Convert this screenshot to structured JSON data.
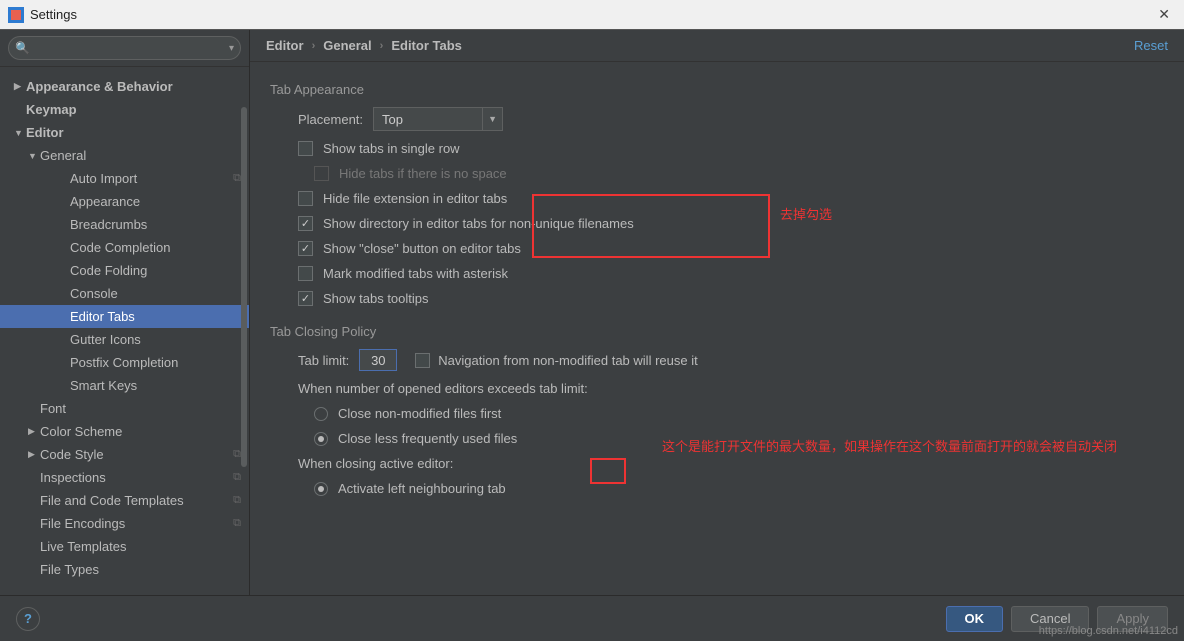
{
  "window": {
    "title": "Settings"
  },
  "search": {
    "placeholder": ""
  },
  "sidebar": {
    "items": [
      {
        "label": "Appearance & Behavior",
        "depth": 0,
        "arrow": "▶",
        "bold": true
      },
      {
        "label": "Keymap",
        "depth": 0,
        "arrow": "",
        "bold": true
      },
      {
        "label": "Editor",
        "depth": 0,
        "arrow": "▼",
        "bold": true
      },
      {
        "label": "General",
        "depth": 1,
        "arrow": "▼"
      },
      {
        "label": "Auto Import",
        "depth": 2,
        "copy": true
      },
      {
        "label": "Appearance",
        "depth": 2
      },
      {
        "label": "Breadcrumbs",
        "depth": 2
      },
      {
        "label": "Code Completion",
        "depth": 2
      },
      {
        "label": "Code Folding",
        "depth": 2
      },
      {
        "label": "Console",
        "depth": 2
      },
      {
        "label": "Editor Tabs",
        "depth": 2,
        "selected": true
      },
      {
        "label": "Gutter Icons",
        "depth": 2
      },
      {
        "label": "Postfix Completion",
        "depth": 2
      },
      {
        "label": "Smart Keys",
        "depth": 2
      },
      {
        "label": "Font",
        "depth": 1,
        "arrow": ""
      },
      {
        "label": "Color Scheme",
        "depth": 1,
        "arrow": "▶"
      },
      {
        "label": "Code Style",
        "depth": 1,
        "arrow": "▶",
        "copy": true
      },
      {
        "label": "Inspections",
        "depth": 1,
        "arrow": "",
        "copy": true
      },
      {
        "label": "File and Code Templates",
        "depth": 1,
        "arrow": "",
        "copy": true
      },
      {
        "label": "File Encodings",
        "depth": 1,
        "arrow": "",
        "copy": true
      },
      {
        "label": "Live Templates",
        "depth": 1,
        "arrow": ""
      },
      {
        "label": "File Types",
        "depth": 1,
        "arrow": ""
      }
    ]
  },
  "breadcrumb": [
    "Editor",
    "General",
    "Editor Tabs"
  ],
  "reset": "Reset",
  "appearance": {
    "title": "Tab Appearance",
    "placement_label": "Placement:",
    "placement_value": "Top",
    "single_row": "Show tabs in single row",
    "hide_no_space": "Hide tabs if there is no space",
    "hide_ext": "Hide file extension in editor tabs",
    "show_dir": "Show directory in editor tabs for non-unique filenames",
    "show_close": "Show \"close\" button on editor tabs",
    "mark_asterisk": "Mark modified tabs with asterisk",
    "tooltips": "Show tabs tooltips"
  },
  "closing": {
    "title": "Tab Closing Policy",
    "tab_limit_label": "Tab limit:",
    "tab_limit_value": "30",
    "nav_reuse": "Navigation from non-modified tab will reuse it",
    "when_exceeds": "When number of opened editors exceeds tab limit:",
    "close_nonmod": "Close non-modified files first",
    "close_lfu": "Close less frequently used files",
    "when_closing": "When closing active editor:",
    "activate_left": "Activate left neighbouring tab"
  },
  "annotations": {
    "a1": "去掉勾选",
    "a2": "这个是能打开文件的最大数量，如果操作在这个数量前面打开的就会被自动关闭"
  },
  "footer": {
    "ok": "OK",
    "cancel": "Cancel",
    "apply": "Apply"
  },
  "watermark": "https://blog.csdn.net/i4112cd"
}
